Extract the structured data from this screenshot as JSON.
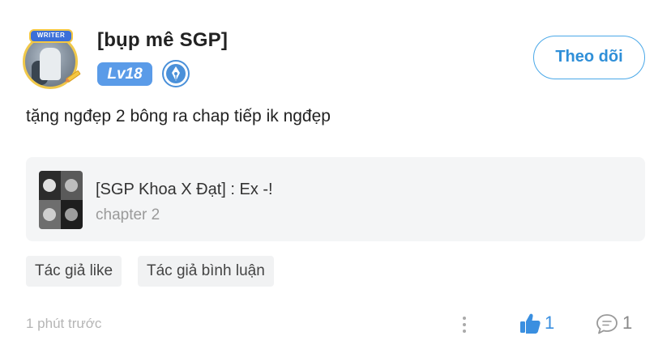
{
  "user": {
    "name": "[bụp mê SGP]",
    "avatar_badge_text": "WRITER",
    "level": "Lv18"
  },
  "actions": {
    "follow_label": "Theo dõi"
  },
  "comment": {
    "text": "tặng ngđẹp 2 bông ra chap tiếp ik ngđẹp",
    "time": "1 phút trước",
    "like_count": "1",
    "reply_count": "1"
  },
  "story": {
    "title": "[SGP Khoa X Đạt] : Ex -!",
    "chapter": "chapter 2"
  },
  "tags": [
    "Tác giả like",
    "Tác giả bình luận"
  ],
  "colors": {
    "accent": "#2f8fd8",
    "level_bg": "#5a9be8",
    "like": "#3a8fe0"
  },
  "icons": {
    "author": "pen-nib-icon",
    "more": "more-vertical-icon",
    "like": "thumbs-up-icon",
    "reply": "speech-bubble-icon"
  }
}
